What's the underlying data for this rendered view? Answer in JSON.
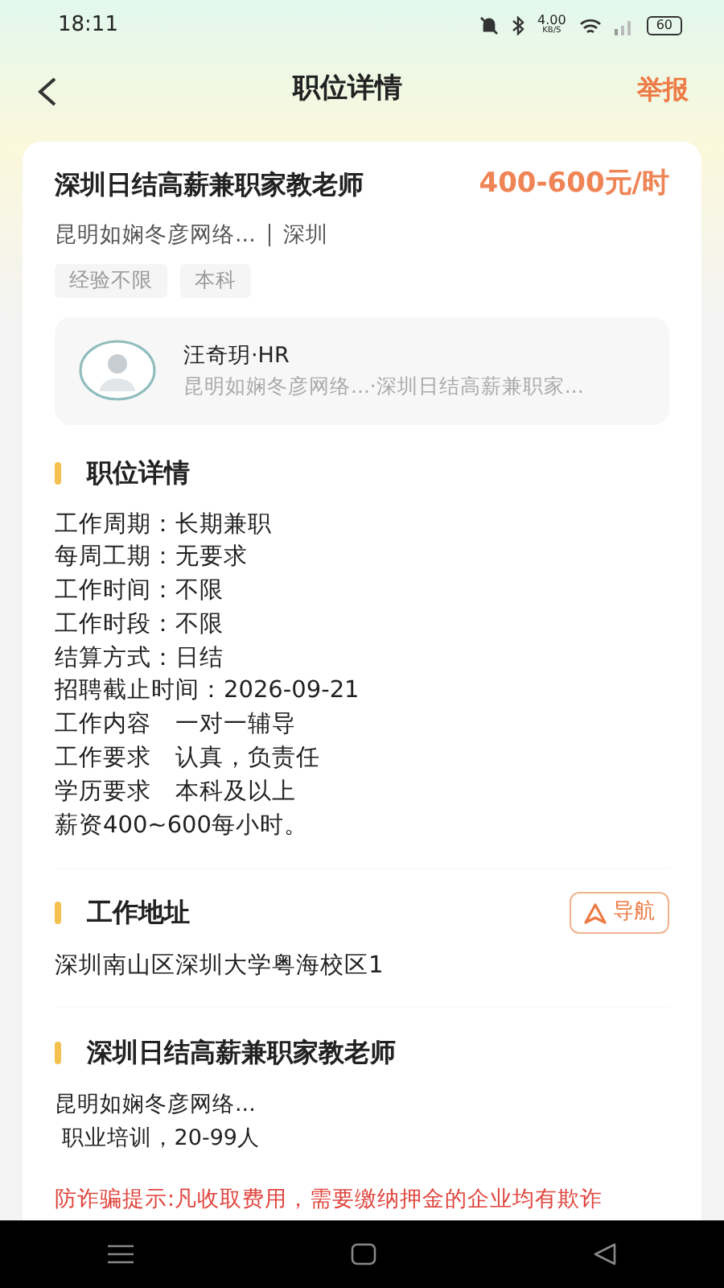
{
  "status_bar": {
    "time": "18:11",
    "speed": "4.00",
    "speed_unit": "KB/S",
    "battery": "60"
  },
  "header": {
    "title": "职位详情",
    "action": "举报"
  },
  "job": {
    "title": "深圳日结高薪兼职家教老师",
    "salary": "400-600元/时",
    "company": "昆明如娴冬彦网络...",
    "city": "深圳",
    "tags": [
      "经验不限",
      "本科"
    ]
  },
  "recruiter": {
    "name": "汪奇玥·HR",
    "subtitle": "昆明如娴冬彦网络...·深圳日结高薪兼职家..."
  },
  "details": {
    "heading": "职位详情",
    "lines": [
      "工作周期：长期兼职",
      "每周工期：无要求",
      "工作时间：不限",
      "工作时段：不限",
      "结算方式：日结",
      "招聘截止时间：2026-09-21",
      "工作内容　一对一辅导",
      "工作要求　认真，负责任",
      "学历要求　本科及以上",
      "薪资400~600每小时。"
    ]
  },
  "address": {
    "heading": "工作地址",
    "button": "导航",
    "text": "深圳南山区深圳大学粤海校区1"
  },
  "company": {
    "heading": "深圳日结高薪兼职家教老师",
    "name": "昆明如娴冬彦网络...",
    "info": " 职业培训，20-99人"
  },
  "warning": "防诈骗提示:凡收取费用，需要缴纳押金的企业均有欺诈"
}
